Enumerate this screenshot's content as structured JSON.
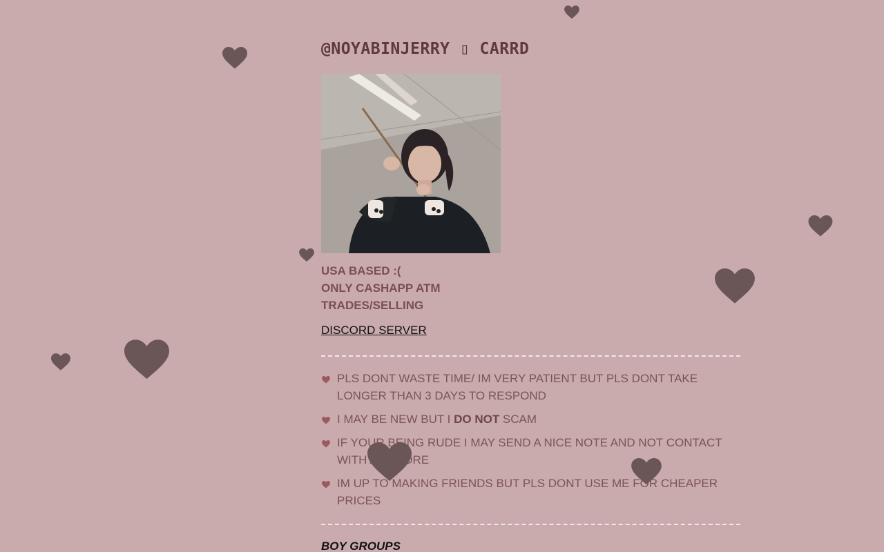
{
  "page": {
    "title": "@NOYABINJERRY ▯ CARRD",
    "photo_alt": "profile-photo"
  },
  "info": {
    "lines": [
      "USA BASED :(",
      "ONLY CASHAPP ATM",
      "TRADES/SELLING"
    ]
  },
  "links": {
    "discord": "DISCORD SERVER"
  },
  "rules": [
    {
      "pre": "PLS DONT WASTE TIME/ IM VERY PATIENT BUT PLS DONT TAKE LONGER THAN 3 DAYS TO RESPOND",
      "bold": "",
      "post": ""
    },
    {
      "pre": "I MAY BE NEW BUT I ",
      "bold": "DO NOT",
      "post": " SCAM"
    },
    {
      "pre": "IF YOUR BEING RUDE I MAY SEND A NICE NOTE AND NOT CONTACT WITH ANYMORE",
      "bold": "",
      "post": ""
    },
    {
      "pre": "IM UP TO MAKING FRIENDS BUT PLS DONT USE ME FOR CHEAPER PRICES",
      "bold": "",
      "post": ""
    }
  ],
  "sections": {
    "boy_groups": "BOY GROUPS"
  },
  "colors": {
    "background": "#caabad",
    "heart": "#6b5657",
    "bullet": "#9b5a5e"
  },
  "icons": {
    "bullet": "heart-icon",
    "decor": "heart-icon"
  }
}
